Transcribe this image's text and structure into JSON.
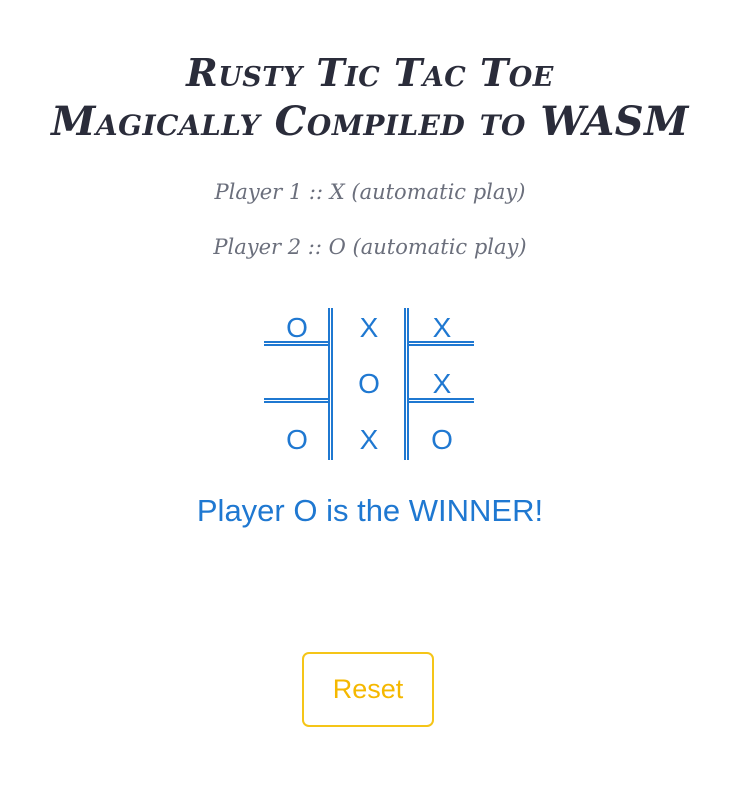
{
  "header": {
    "title_line1": "Rusty Tic Tac Toe",
    "title_line2": "Magically Compiled to WASM"
  },
  "players": {
    "player1": "Player 1 :: X (automatic play)",
    "player2": "Player 2 :: O (automatic play)"
  },
  "board": {
    "cells": [
      [
        "O",
        "X",
        "X"
      ],
      [
        "",
        "O",
        "X"
      ],
      [
        "O",
        "X",
        "O"
      ]
    ]
  },
  "status": "Player O is the WINNER!",
  "controls": {
    "reset_label": "Reset"
  },
  "colors": {
    "title": "#2a2c3a",
    "subtitle": "#6b6f7c",
    "board": "#1f78d1",
    "status": "#1f78d1",
    "reset": "#f5c518"
  }
}
